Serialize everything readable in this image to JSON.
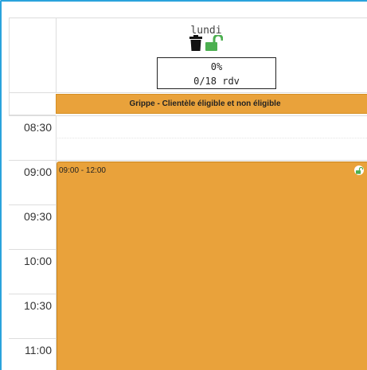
{
  "day": {
    "name": "lundi",
    "percent": "0%",
    "appointments": "0/18 rdv",
    "delete_icon": "trash-icon",
    "lock_icon": "unlock-icon"
  },
  "all_day_event": {
    "label": "Grippe - Clientèle éligible et non éligible"
  },
  "time_slots": [
    "08:30",
    "09:00",
    "09:30",
    "10:00",
    "10:30",
    "11:00"
  ],
  "event": {
    "time_range": "09:00 - 12:00",
    "lock_icon": "unlock-icon"
  },
  "colors": {
    "frame_border": "#2aa3dc",
    "event_orange": "#e9a23b",
    "lock_green": "#4caf50"
  }
}
